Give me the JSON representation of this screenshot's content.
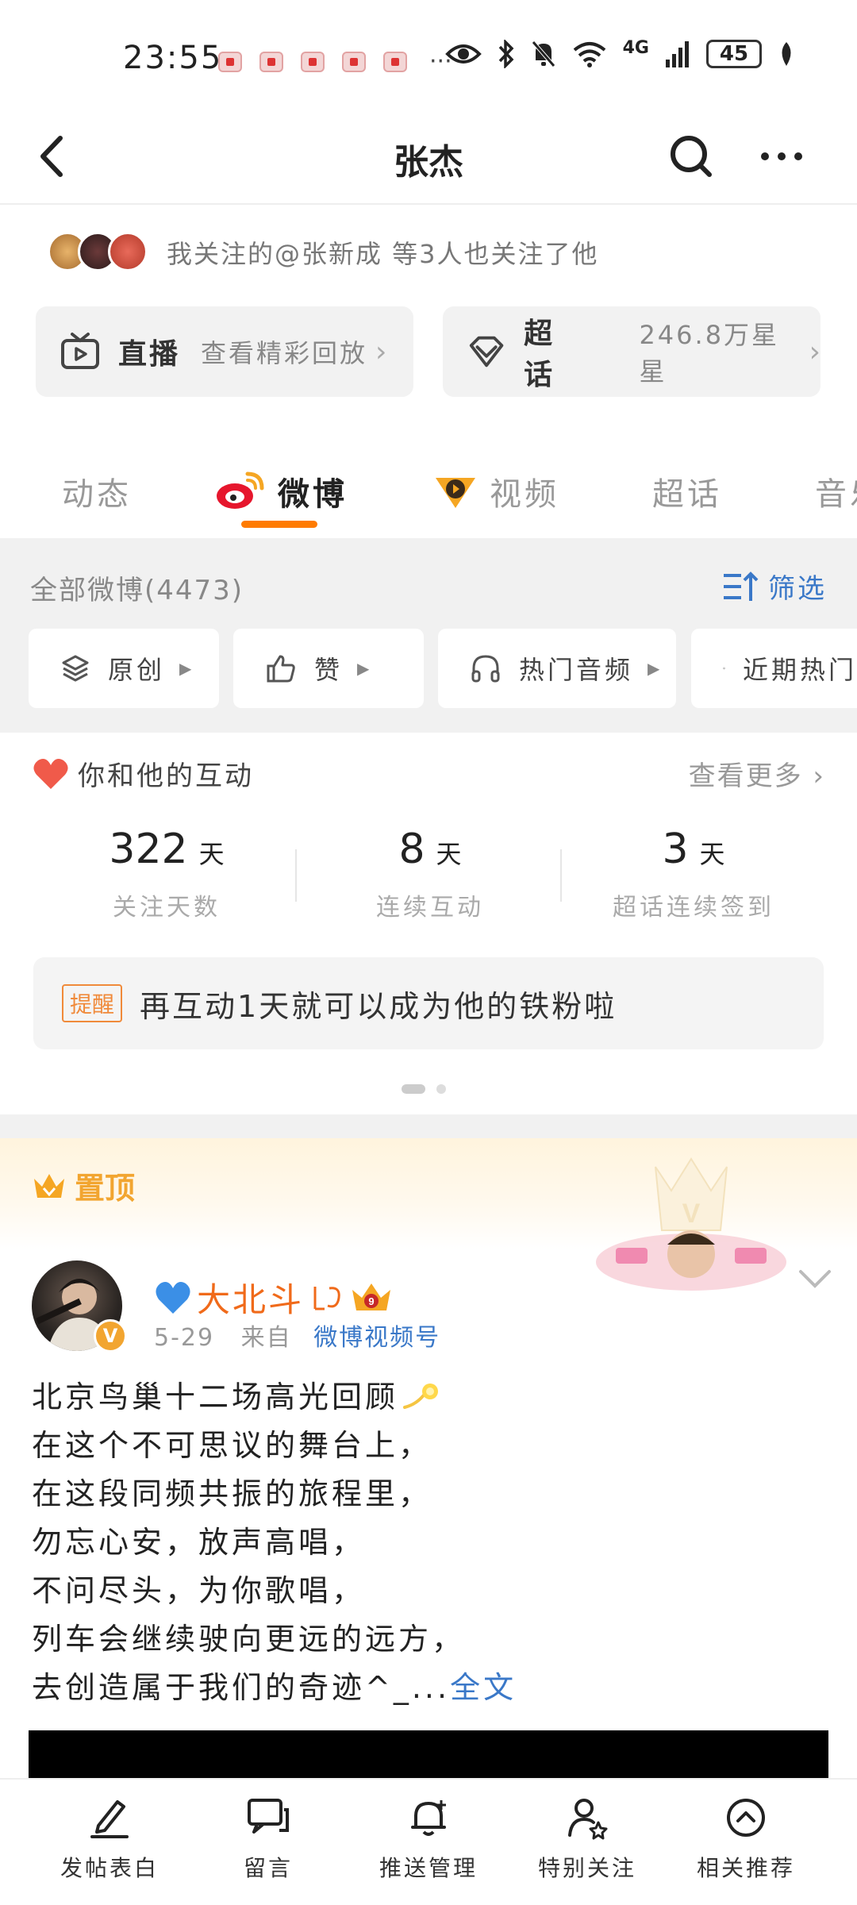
{
  "status_bar": {
    "time": "23:55",
    "battery": "45",
    "network": "4G",
    "more": "···"
  },
  "header": {
    "title": "张杰"
  },
  "follow": {
    "text": "我关注的@张新成 等3人也关注了他"
  },
  "quick_cards": [
    {
      "title": "直播",
      "subtitle": "查看精彩回放",
      "icon": "tv-icon"
    },
    {
      "title": "超话",
      "subtitle": "246.8万星星",
      "icon": "diamond-icon"
    }
  ],
  "tabs": [
    "动态",
    "微博",
    "视频",
    "超话",
    "音乐"
  ],
  "active_tab": "微博",
  "filter": {
    "title": "全部微博(4473)",
    "filter_label": "筛选",
    "chips": [
      "原创",
      "赞",
      "热门音频",
      "近期热门"
    ]
  },
  "interaction": {
    "title": "你和他的互动",
    "more": "查看更多",
    "stats": [
      {
        "value": "322",
        "unit": "天",
        "label": "关注天数"
      },
      {
        "value": "8",
        "unit": "天",
        "label": "连续互动"
      },
      {
        "value": "3",
        "unit": "天",
        "label": "超话连续签到"
      }
    ],
    "tip_badge": "提醒",
    "tip_text": "再互动1天就可以成为他的铁粉啦"
  },
  "pinned": {
    "label": "置顶"
  },
  "post": {
    "author": "大北斗",
    "date": "5-29",
    "from_prefix": "来自",
    "source": "微博视频号",
    "lines": [
      "北京鸟巢十二场高光回顾",
      "在这个不可思议的舞台上，",
      "在这段同频共振的旅程里，",
      "勿忘心安，放声高唱，",
      "不问尽头，为你歌唱，",
      "列车会继续驶向更远的远方，",
      "去创造属于我们的奇迹^_..."
    ],
    "full_text_link": "全文"
  },
  "bottom_bar": [
    {
      "label": "发帖表白",
      "icon": "pen-icon"
    },
    {
      "label": "留言",
      "icon": "message-icon"
    },
    {
      "label": "推送管理",
      "icon": "bell-icon"
    },
    {
      "label": "特别关注",
      "icon": "user-star-icon"
    },
    {
      "label": "相关推荐",
      "icon": "up-circle-icon"
    }
  ]
}
